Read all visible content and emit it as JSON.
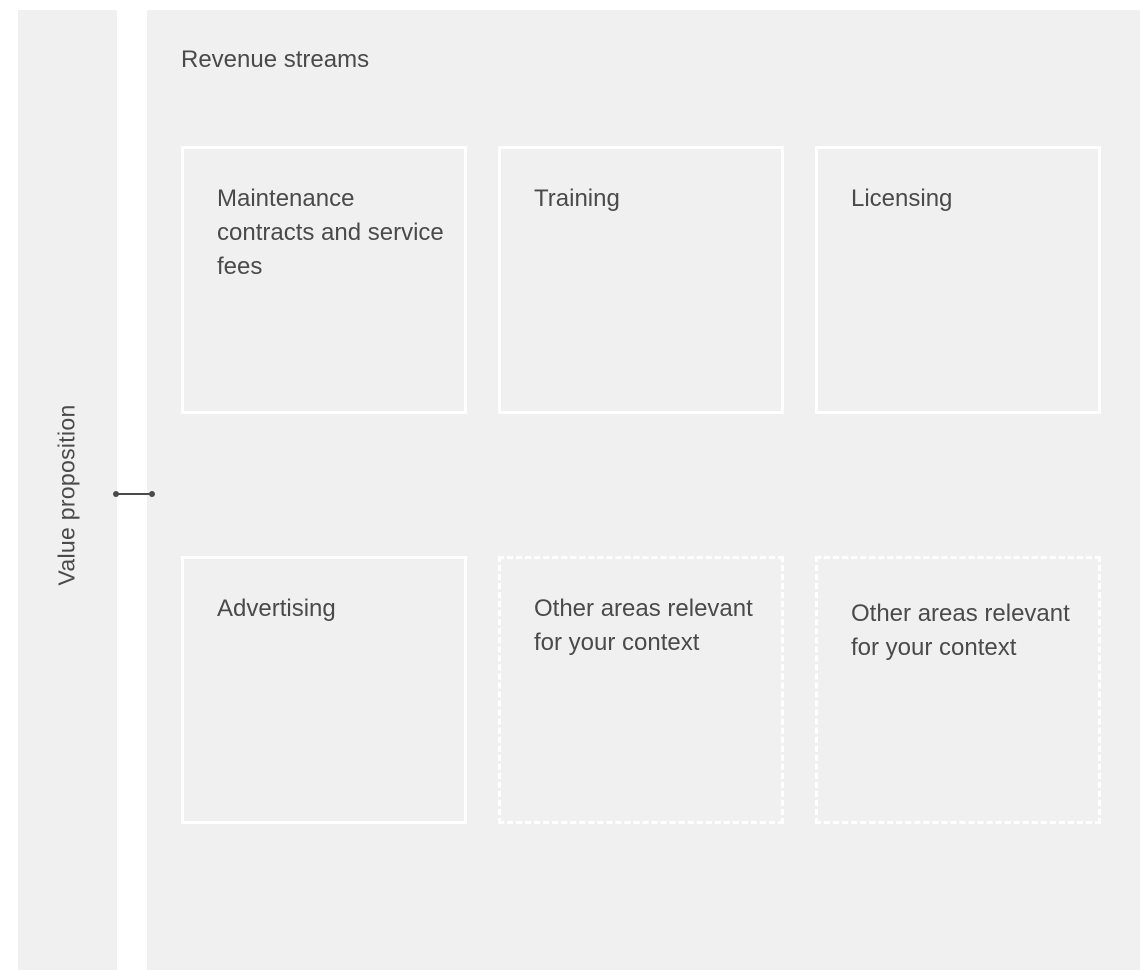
{
  "side_panel": {
    "label": "Value proposition"
  },
  "main_panel": {
    "title": "Revenue streams",
    "cards": [
      {
        "text": "Maintenance contracts and service fees",
        "style": "solid"
      },
      {
        "text": "Training",
        "style": "solid"
      },
      {
        "text": "Licensing",
        "style": "solid"
      },
      {
        "text": "Advertising",
        "style": "solid"
      },
      {
        "text": "Other areas relevant for your context",
        "style": "dashed"
      },
      {
        "text": "Other areas relevant for your context",
        "style": "dashed"
      }
    ]
  },
  "colors": {
    "panel_bg": "#f0f0f0",
    "card_border": "#ffffff",
    "text": "#4a4a4a",
    "connector": "#4a4a4a"
  }
}
